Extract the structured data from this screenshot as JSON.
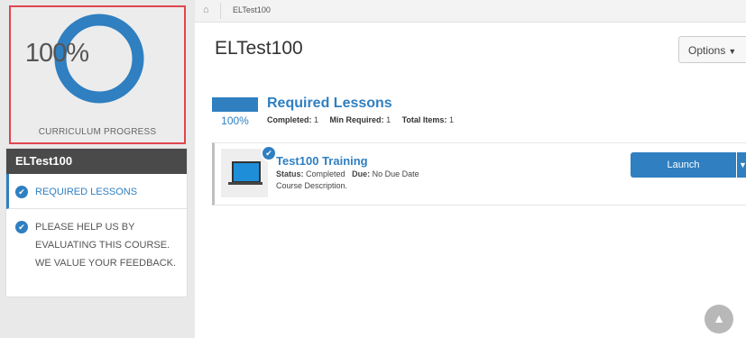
{
  "breadcrumb": {
    "current": "ELTest100"
  },
  "progress": {
    "percent": 100,
    "percent_text": "100%",
    "label": "CURRICULUM PROGRESS",
    "ring_color": "#2f7fc1"
  },
  "sidebar": {
    "course_title": "ELTest100",
    "items": [
      {
        "label": "REQUIRED LESSONS",
        "active": true
      },
      {
        "label": "PLEASE HELP US BY EVALUATING THIS COURSE. WE VALUE YOUR FEEDBACK.",
        "active": false
      }
    ]
  },
  "header": {
    "title": "ELTest100",
    "options_label": "Options"
  },
  "section": {
    "title": "Required Lessons",
    "percent_text": "100%",
    "completed_label": "Completed:",
    "completed_value": "1",
    "min_label": "Min Required:",
    "min_value": "1",
    "total_label": "Total Items:",
    "total_value": "1"
  },
  "lesson": {
    "title": "Test100 Training",
    "status_label": "Status:",
    "status_value": "Completed",
    "due_label": "Due:",
    "due_value": "No Due Date",
    "description": "Course Description.",
    "launch_label": "Launch"
  },
  "colors": {
    "accent": "#2f7fc1",
    "highlight_border": "#e0464e",
    "sidebar_head": "#4a4a4a"
  }
}
